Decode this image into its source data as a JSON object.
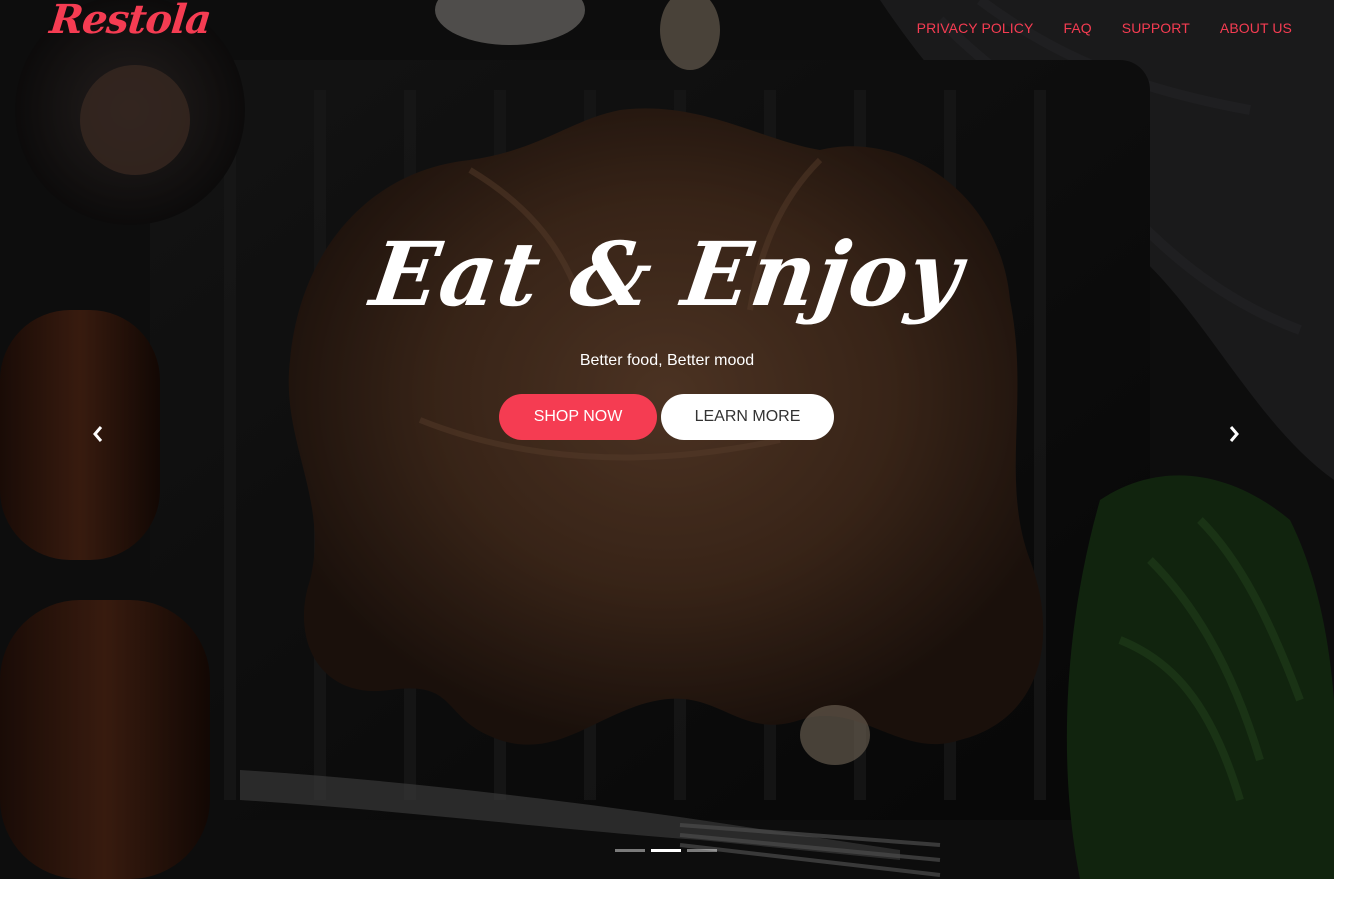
{
  "brand": {
    "name": "Restola",
    "accent": "#f53c52"
  },
  "nav": {
    "items": [
      {
        "label": "PRIVACY POLICY"
      },
      {
        "label": "FAQ"
      },
      {
        "label": "SUPPORT"
      },
      {
        "label": "ABOUT US"
      }
    ]
  },
  "hero": {
    "title": "Eat & Enjoy",
    "subtitle": "Better food, Better mood",
    "primary_button": "SHOP NOW",
    "secondary_button": "LEARN MORE",
    "prev_icon": "chevron-left-icon",
    "next_icon": "chevron-right-icon",
    "slide_count": 3,
    "active_slide": 2
  }
}
